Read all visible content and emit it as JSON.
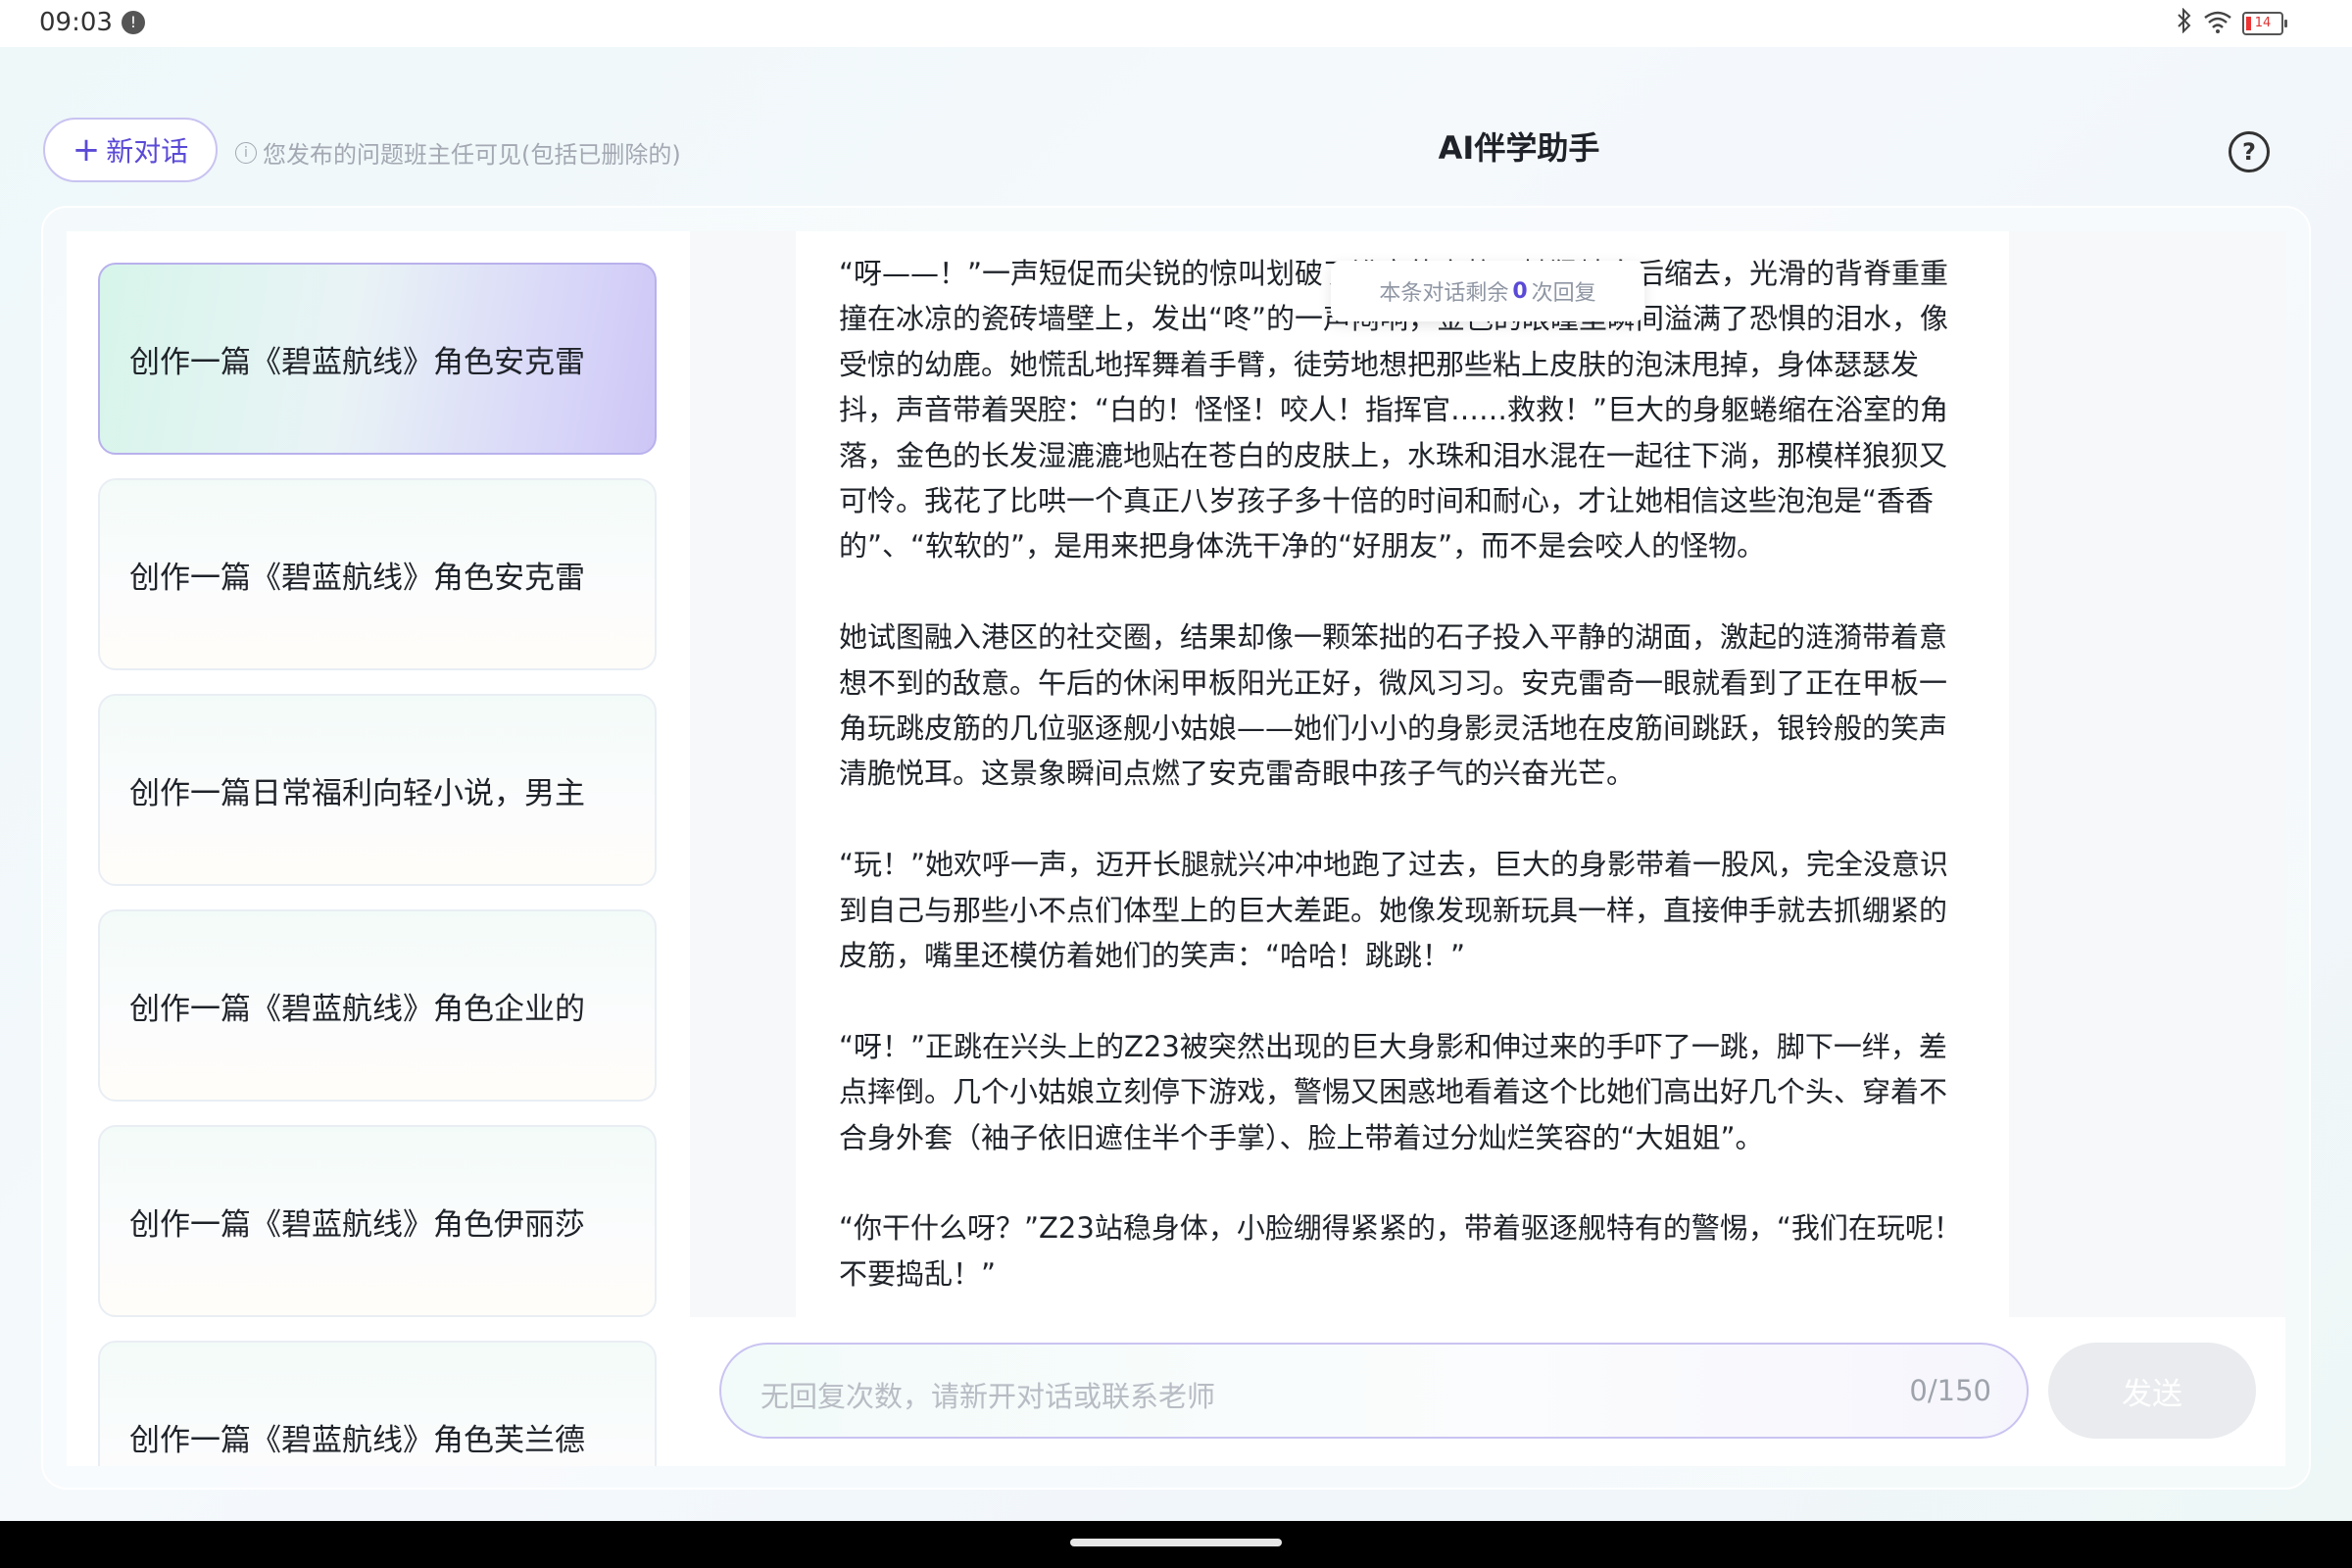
{
  "status_bar": {
    "time": "09:03",
    "notification_badge": "!",
    "battery_level": "14",
    "battery_color": "#e33333"
  },
  "header": {
    "new_chat_label": "新对话",
    "notice": "您发布的问题班主任可见(包括已删除的)",
    "title": "AI伴学助手",
    "help_icon": "?"
  },
  "sidebar": {
    "items": [
      {
        "label": "创作一篇《碧蓝航线》角色安克雷",
        "active": true
      },
      {
        "label": "创作一篇《碧蓝航线》角色安克雷",
        "active": false
      },
      {
        "label": "创作一篇日常福利向轻小说，男主",
        "active": false
      },
      {
        "label": "创作一篇《碧蓝航线》角色企业的",
        "active": false
      },
      {
        "label": "创作一篇《碧蓝航线》角色伊丽莎",
        "active": false
      },
      {
        "label": "创作一篇《碧蓝航线》角色芙兰德",
        "active": false
      }
    ]
  },
  "toast": {
    "prefix": "本条对话剩余",
    "count": "0",
    "suffix": "次回复"
  },
  "message": {
    "paragraphs": [
      "“呀——！”一声短促而尖锐的惊叫划破了浴室的宁静。她猛地向后缩去，光滑的背脊重重撞在冰凉的瓷砖墙壁上，发出“咚”的一声闷响，金色的眼瞳里瞬间溢满了恐惧的泪水，像受惊的幼鹿。她慌乱地挥舞着手臂，徒劳地想把那些粘上皮肤的泡沫甩掉，身体瑟瑟发抖，声音带着哭腔：“白的！怪怪！咬人！指挥官……救救！”巨大的身躯蜷缩在浴室的角落，金色的长发湿漉漉地贴在苍白的皮肤上，水珠和泪水混在一起往下淌，那模样狼狈又可怜。我花了比哄一个真正八岁孩子多十倍的时间和耐心，才让她相信这些泡泡是“香香的”、“软软的”，是用来把身体洗干净的“好朋友”，而不是会咬人的怪物。",
      "她试图融入港区的社交圈，结果却像一颗笨拙的石子投入平静的湖面，激起的涟漪带着意想不到的敌意。午后的休闲甲板阳光正好，微风习习。安克雷奇一眼就看到了正在甲板一角玩跳皮筋的几位驱逐舰小姑娘——她们小小的身影灵活地在皮筋间跳跃，银铃般的笑声清脆悦耳。这景象瞬间点燃了安克雷奇眼中孩子气的兴奋光芒。",
      "“玩！”她欢呼一声，迈开长腿就兴冲冲地跑了过去，巨大的身影带着一股风，完全没意识到自己与那些小不点们体型上的巨大差距。她像发现新玩具一样，直接伸手就去抓绷紧的皮筋，嘴里还模仿着她们的笑声：“哈哈！跳跳！”",
      "“呀！”正跳在兴头上的Z23被突然出现的巨大身影和伸过来的手吓了一跳，脚下一绊，差点摔倒。几个小姑娘立刻停下游戏，警惕又困惑地看着这个比她们高出好几个头、穿着不合身外套（袖子依旧遮住半个手掌）、脸上带着过分灿烂笑容的“大姐姐”。",
      "“你干什么呀？”Z23站稳身体，小脸绷得紧紧的，带着驱逐舰特有的警惕，“我们在玩呢！不要捣乱！”"
    ]
  },
  "input": {
    "placeholder": "无回复次数，请新开对话或联系老师",
    "counter": "0/150",
    "send_label": "发送"
  },
  "colors": {
    "accent": "#5a4ad6",
    "accent_border": "#c9c3f1",
    "send_disabled": "#e9ebee"
  }
}
